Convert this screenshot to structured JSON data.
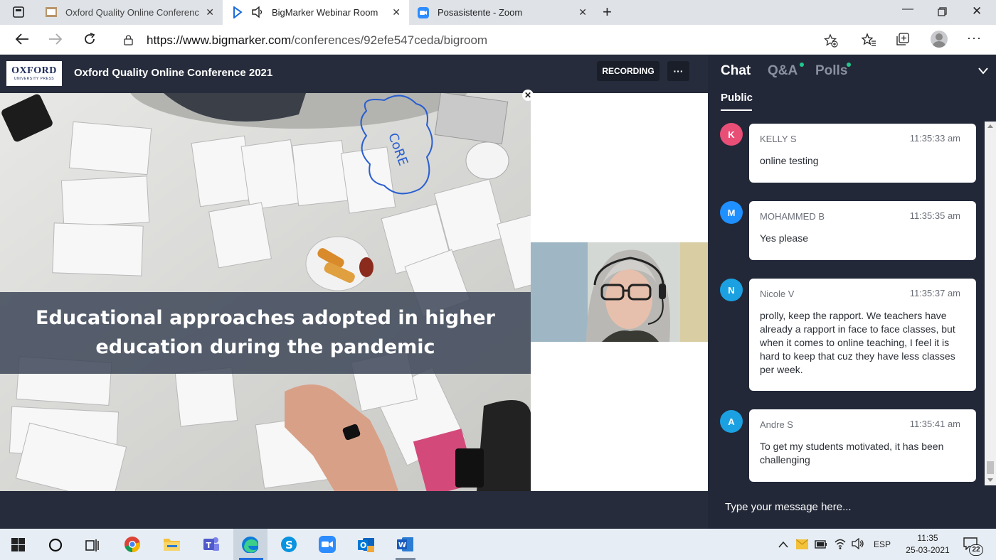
{
  "tabs": [
    {
      "label": "Oxford Quality Online Conferenc",
      "active": false
    },
    {
      "label": "BigMarker Webinar Room",
      "active": true
    },
    {
      "label": "Posasistente - Zoom",
      "active": false
    }
  ],
  "address": {
    "prefix": "https://www.bigmarker.com",
    "path": "/conferences/92efe547ceda/bigroom"
  },
  "header": {
    "logo_line1": "OXFORD",
    "logo_line2": "UNIVERSITY PRESS",
    "title": "Oxford Quality Online Conference 2021",
    "recording_label": "RECORDING",
    "more_label": "···"
  },
  "video": {
    "caption_line1": "Educational approaches adopted in higher",
    "caption_line2": "education during the pandemic",
    "cloud_text": "CoRE"
  },
  "chat": {
    "tabs": [
      "Chat",
      "Q&A",
      "Polls"
    ],
    "subtab": "Public",
    "messages": [
      {
        "initial": "K",
        "name": "KELLY S",
        "time": "11:35:33 am",
        "text": "online testing",
        "color": "#e94e77"
      },
      {
        "initial": "M",
        "name": "MOHAMMED B",
        "time": "11:35:35 am",
        "text": "Yes please",
        "color": "#1e90ff"
      },
      {
        "initial": "N",
        "name": "Nicole V",
        "time": "11:35:37 am",
        "text": "prolly, keep the rapport. We teachers have already a rapport in face to face classes, but when it comes to online teaching, I feel it is hard to keep that cuz they have less classes per week.",
        "color": "#1ba1e2"
      },
      {
        "initial": "A",
        "name": "Andre S",
        "time": "11:35:41 am",
        "text": "To get my students motivated, it has been challenging",
        "color": "#1ba1e2"
      }
    ],
    "input_placeholder": "Type your message here..."
  },
  "taskbar": {
    "lang": "ESP",
    "time": "11:35",
    "date": "25-03-2021",
    "notifications": "22"
  },
  "colors": {
    "accent_green": "#22c78b",
    "page_bg": "#262c3b",
    "chat_bg": "#222838"
  }
}
